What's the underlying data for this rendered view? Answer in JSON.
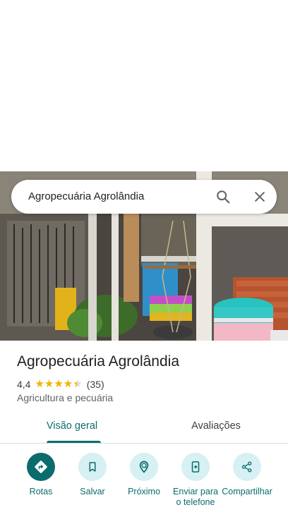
{
  "search": {
    "query": "Agropecuária Agrolândia"
  },
  "place": {
    "name": "Agropecuária Agrolândia",
    "rating": "4,4",
    "rating_fraction": 0.88,
    "review_count": "(35)",
    "category": "Agricultura e pecuária"
  },
  "tabs": [
    {
      "label": "Visão geral",
      "active": true
    },
    {
      "label": "Avaliações",
      "active": false
    }
  ],
  "actions": [
    {
      "label": "Rotas",
      "icon": "directions-icon"
    },
    {
      "label": "Salvar",
      "icon": "bookmark-icon"
    },
    {
      "label": "Próximo",
      "icon": "nearby-icon"
    },
    {
      "label": "Enviar para o telefone",
      "icon": "send-to-phone-icon"
    },
    {
      "label": "Compartilhar",
      "icon": "share-icon"
    }
  ],
  "colors": {
    "accent": "#0b6c6e",
    "action_bg": "#d6f0f3",
    "star": "#f4b400"
  }
}
